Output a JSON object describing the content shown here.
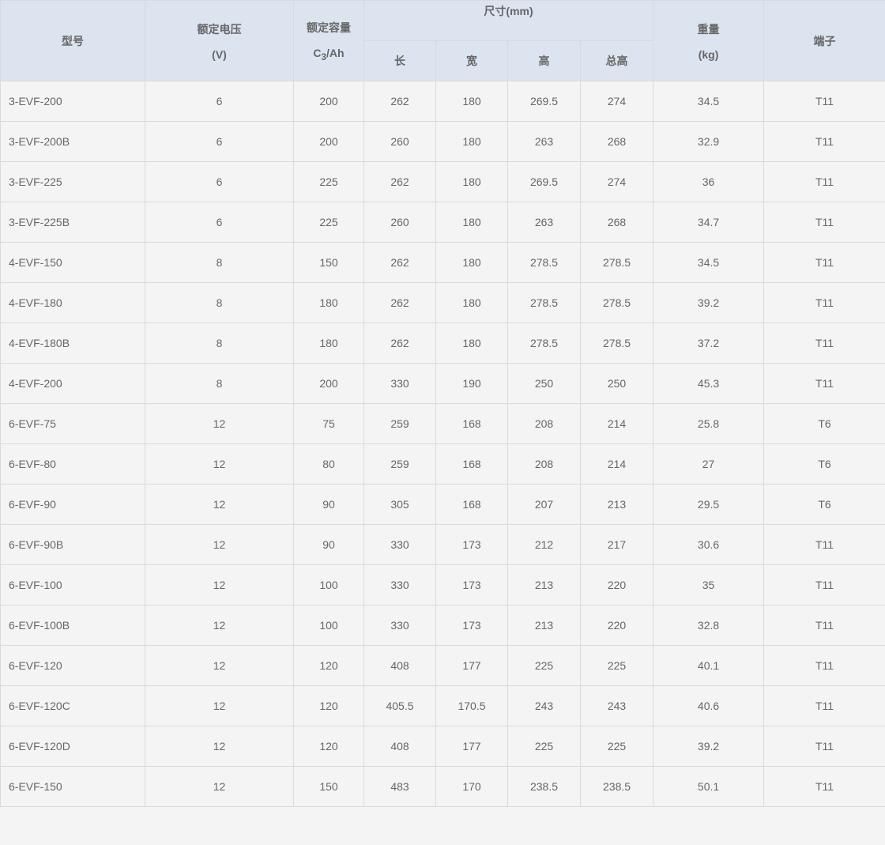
{
  "headers": {
    "model": "型号",
    "voltage": "额定电压",
    "voltage_unit": "(V)",
    "capacity": "额定容量",
    "capacity_unit_c": "C",
    "capacity_unit_sub": "3",
    "capacity_unit_rest": "/Ah",
    "dimensions": "尺寸(mm)",
    "length": "长",
    "width": "宽",
    "height": "高",
    "total_height": "总高",
    "weight": "重量",
    "weight_unit": "(kg)",
    "terminal": "端子"
  },
  "rows": [
    {
      "model": "3-EVF-200",
      "voltage": "6",
      "capacity": "200",
      "length": "262",
      "width": "180",
      "height": "269.5",
      "total_height": "274",
      "weight": "34.5",
      "terminal": "T11"
    },
    {
      "model": "3-EVF-200B",
      "voltage": "6",
      "capacity": "200",
      "length": "260",
      "width": "180",
      "height": "263",
      "total_height": "268",
      "weight": "32.9",
      "terminal": "T11"
    },
    {
      "model": "3-EVF-225",
      "voltage": "6",
      "capacity": "225",
      "length": "262",
      "width": "180",
      "height": "269.5",
      "total_height": "274",
      "weight": "36",
      "terminal": "T11"
    },
    {
      "model": "3-EVF-225B",
      "voltage": "6",
      "capacity": "225",
      "length": "260",
      "width": "180",
      "height": "263",
      "total_height": "268",
      "weight": "34.7",
      "terminal": "T11"
    },
    {
      "model": "4-EVF-150",
      "voltage": "8",
      "capacity": "150",
      "length": "262",
      "width": "180",
      "height": "278.5",
      "total_height": "278.5",
      "weight": "34.5",
      "terminal": "T11"
    },
    {
      "model": "4-EVF-180",
      "voltage": "8",
      "capacity": "180",
      "length": "262",
      "width": "180",
      "height": "278.5",
      "total_height": "278.5",
      "weight": "39.2",
      "terminal": "T11"
    },
    {
      "model": "4-EVF-180B",
      "voltage": "8",
      "capacity": "180",
      "length": "262",
      "width": "180",
      "height": "278.5",
      "total_height": "278.5",
      "weight": "37.2",
      "terminal": "T11"
    },
    {
      "model": "4-EVF-200",
      "voltage": "8",
      "capacity": "200",
      "length": "330",
      "width": "190",
      "height": "250",
      "total_height": "250",
      "weight": "45.3",
      "terminal": "T11"
    },
    {
      "model": "6-EVF-75",
      "voltage": "12",
      "capacity": "75",
      "length": "259",
      "width": "168",
      "height": "208",
      "total_height": "214",
      "weight": "25.8",
      "terminal": "T6"
    },
    {
      "model": "6-EVF-80",
      "voltage": "12",
      "capacity": "80",
      "length": "259",
      "width": "168",
      "height": "208",
      "total_height": "214",
      "weight": "27",
      "terminal": "T6"
    },
    {
      "model": "6-EVF-90",
      "voltage": "12",
      "capacity": "90",
      "length": "305",
      "width": "168",
      "height": "207",
      "total_height": "213",
      "weight": "29.5",
      "terminal": "T6"
    },
    {
      "model": "6-EVF-90B",
      "voltage": "12",
      "capacity": "90",
      "length": "330",
      "width": "173",
      "height": "212",
      "total_height": "217",
      "weight": "30.6",
      "terminal": "T11"
    },
    {
      "model": "6-EVF-100",
      "voltage": "12",
      "capacity": "100",
      "length": "330",
      "width": "173",
      "height": "213",
      "total_height": "220",
      "weight": "35",
      "terminal": "T11"
    },
    {
      "model": "6-EVF-100B",
      "voltage": "12",
      "capacity": "100",
      "length": "330",
      "width": "173",
      "height": "213",
      "total_height": "220",
      "weight": "32.8",
      "terminal": "T11"
    },
    {
      "model": "6-EVF-120",
      "voltage": "12",
      "capacity": "120",
      "length": "408",
      "width": "177",
      "height": "225",
      "total_height": "225",
      "weight": "40.1",
      "terminal": "T11"
    },
    {
      "model": "6-EVF-120C",
      "voltage": "12",
      "capacity": "120",
      "length": "405.5",
      "width": "170.5",
      "height": "243",
      "total_height": "243",
      "weight": "40.6",
      "terminal": "T11"
    },
    {
      "model": "6-EVF-120D",
      "voltage": "12",
      "capacity": "120",
      "length": "408",
      "width": "177",
      "height": "225",
      "total_height": "225",
      "weight": "39.2",
      "terminal": "T11"
    },
    {
      "model": "6-EVF-150",
      "voltage": "12",
      "capacity": "150",
      "length": "483",
      "width": "170",
      "height": "238.5",
      "total_height": "238.5",
      "weight": "50.1",
      "terminal": "T11"
    }
  ]
}
